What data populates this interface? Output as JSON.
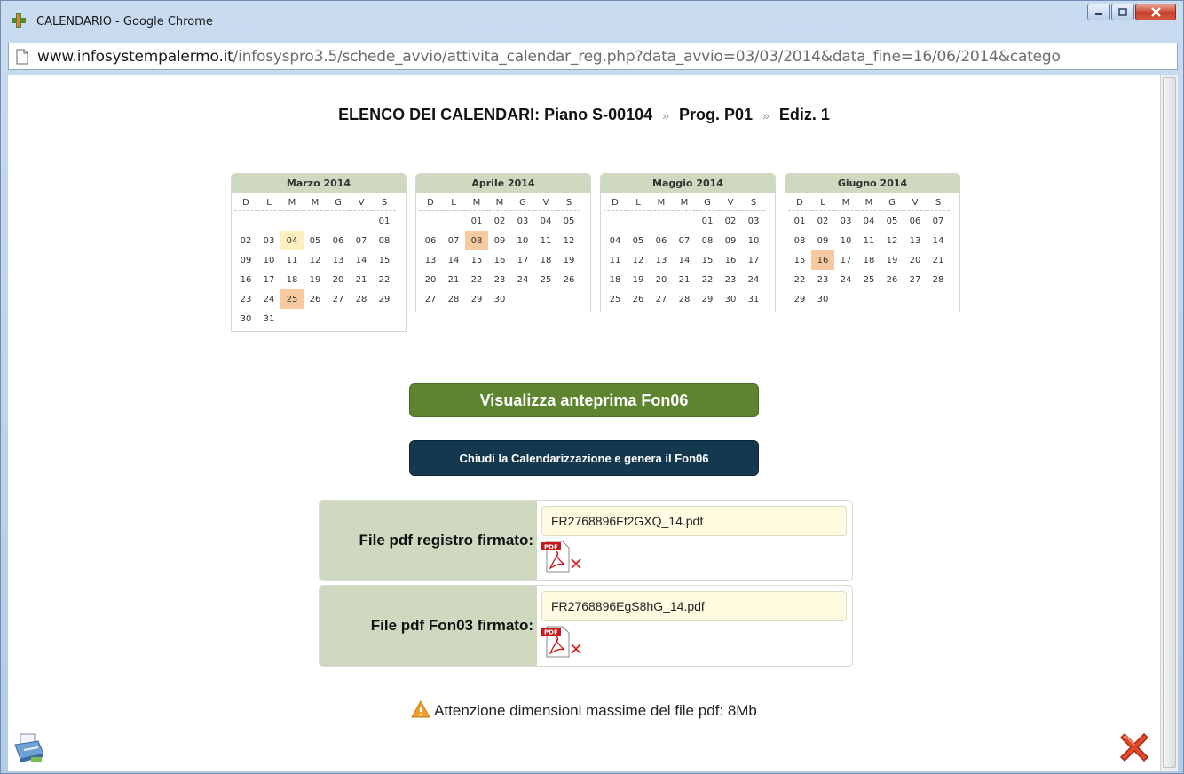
{
  "window": {
    "title": "CALENDARIO - Google Chrome",
    "url_host": "www.infosystempalermo.it",
    "url_path": "/infosyspro3.5/schede_avvio/attivita_calendar_reg.php?data_avvio=03/03/2014&data_fine=16/06/2014&catego"
  },
  "heading": {
    "main": "ELENCO DEI CALENDARI: Piano S-00104",
    "sep1": "»",
    "prog": "Prog. P01",
    "sep2": "»",
    "ediz": "Ediz. 1"
  },
  "calendars": [
    {
      "title": "Marzo 2014",
      "weekdays": [
        "D",
        "L",
        "M",
        "M",
        "G",
        "V",
        "S"
      ],
      "weeks": [
        [
          "",
          "",
          "",
          "",
          "",
          "",
          "01"
        ],
        [
          "02",
          "03",
          "04",
          "05",
          "06",
          "07",
          "08"
        ],
        [
          "09",
          "10",
          "11",
          "12",
          "13",
          "14",
          "15"
        ],
        [
          "16",
          "17",
          "18",
          "19",
          "20",
          "21",
          "22"
        ],
        [
          "23",
          "24",
          "25",
          "26",
          "27",
          "28",
          "29"
        ],
        [
          "30",
          "31",
          "",
          "",
          "",
          "",
          ""
        ]
      ],
      "highlight_yellow": [
        "04"
      ],
      "highlight_orange": [
        "25"
      ]
    },
    {
      "title": "Aprile 2014",
      "weekdays": [
        "D",
        "L",
        "M",
        "M",
        "G",
        "V",
        "S"
      ],
      "weeks": [
        [
          "",
          "",
          "01",
          "02",
          "03",
          "04",
          "05"
        ],
        [
          "06",
          "07",
          "08",
          "09",
          "10",
          "11",
          "12"
        ],
        [
          "13",
          "14",
          "15",
          "16",
          "17",
          "18",
          "19"
        ],
        [
          "20",
          "21",
          "22",
          "23",
          "24",
          "25",
          "26"
        ],
        [
          "27",
          "28",
          "29",
          "30",
          "",
          "",
          ""
        ]
      ],
      "highlight_yellow": [],
      "highlight_orange": [
        "08"
      ]
    },
    {
      "title": "Maggio 2014",
      "weekdays": [
        "D",
        "L",
        "M",
        "M",
        "G",
        "V",
        "S"
      ],
      "weeks": [
        [
          "",
          "",
          "",
          "",
          "01",
          "02",
          "03"
        ],
        [
          "04",
          "05",
          "06",
          "07",
          "08",
          "09",
          "10"
        ],
        [
          "11",
          "12",
          "13",
          "14",
          "15",
          "16",
          "17"
        ],
        [
          "18",
          "19",
          "20",
          "21",
          "22",
          "23",
          "24"
        ],
        [
          "25",
          "26",
          "27",
          "28",
          "29",
          "30",
          "31"
        ]
      ],
      "highlight_yellow": [],
      "highlight_orange": []
    },
    {
      "title": "Giugno 2014",
      "weekdays": [
        "D",
        "L",
        "M",
        "M",
        "G",
        "V",
        "S"
      ],
      "weeks": [
        [
          "01",
          "02",
          "03",
          "04",
          "05",
          "06",
          "07"
        ],
        [
          "08",
          "09",
          "10",
          "11",
          "12",
          "13",
          "14"
        ],
        [
          "15",
          "16",
          "17",
          "18",
          "19",
          "20",
          "21"
        ],
        [
          "22",
          "23",
          "24",
          "25",
          "26",
          "27",
          "28"
        ],
        [
          "29",
          "30",
          "",
          "",
          "",
          "",
          ""
        ]
      ],
      "highlight_yellow": [],
      "highlight_orange": [
        "16"
      ]
    }
  ],
  "buttons": {
    "preview": "Visualizza anteprima Fon06",
    "close_generate": "Chiudi la Calendarizzazione e genera il Fon06"
  },
  "files": [
    {
      "label": "File pdf registro firmato:",
      "value": "FR2768896Ff2GXQ_14.pdf"
    },
    {
      "label": "File pdf Fon03 firmato:",
      "value": "FR2768896EgS8hG_14.pdf"
    }
  ],
  "pdf_icon_text": "PDF",
  "warning": "Attenzione dimensioni massime del file pdf: 8Mb",
  "colors": {
    "green_button": "#5d852f",
    "navy_button": "#14394e",
    "label_bg": "#ced9c0",
    "input_bg": "#fffbe1",
    "highlight_yellow": "#fcefc0",
    "highlight_orange": "#f7c9a0"
  }
}
